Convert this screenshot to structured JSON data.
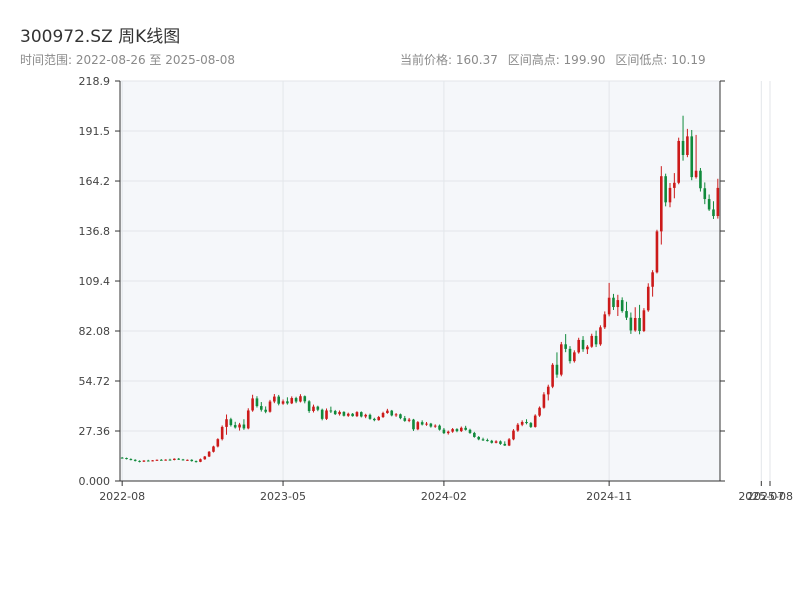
{
  "header": {
    "title": "300972.SZ 周K线图",
    "range_label": "时间范围: 2022-08-26 至 2025-08-08",
    "stats": [
      "当前价格: 160.37",
      "区间高点: 199.90",
      "区间低点: 10.19"
    ]
  },
  "chart_data": {
    "type": "candlestick",
    "title": "300972.SZ 周K线图",
    "ylim": [
      0,
      218.9
    ],
    "y_ticks": [
      "0.000",
      "27.36",
      "54.72",
      "82.08",
      "109.4",
      "136.8",
      "164.2",
      "191.5",
      "218.9"
    ],
    "y_tick_values": [
      0,
      27.36,
      54.72,
      82.08,
      109.44,
      136.8,
      164.16,
      191.52,
      218.9
    ],
    "x_ticks": [
      {
        "label": "2022-08",
        "index": 0
      },
      {
        "label": "2023-05",
        "index": 37
      },
      {
        "label": "2024-02",
        "index": 74
      },
      {
        "label": "2024-11",
        "index": 112
      },
      {
        "label": "2025-07",
        "index": 147
      },
      {
        "label": "2025-08",
        "index": 149
      }
    ],
    "grid": true,
    "colors": {
      "up": "#cc1a1a",
      "down": "#118a3c",
      "plot_bg": "#f5f7fa",
      "grid": "#e3e6ea",
      "axis": "#333333"
    },
    "candles": [
      [
        12.8,
        13.1,
        12.3,
        12.6
      ],
      [
        12.6,
        12.8,
        11.8,
        12.0
      ],
      [
        12.0,
        12.4,
        11.3,
        11.6
      ],
      [
        11.6,
        11.9,
        10.7,
        11.0
      ],
      [
        11.0,
        11.3,
        10.2,
        10.6
      ],
      [
        10.6,
        11.4,
        10.4,
        11.2
      ],
      [
        11.2,
        11.6,
        10.8,
        11.0
      ],
      [
        11.0,
        11.5,
        10.7,
        11.3
      ],
      [
        11.3,
        11.8,
        11.0,
        11.6
      ],
      [
        11.6,
        12.0,
        11.2,
        11.4
      ],
      [
        11.4,
        11.9,
        11.1,
        11.7
      ],
      [
        11.7,
        12.2,
        11.3,
        11.5
      ],
      [
        11.5,
        12.4,
        11.3,
        12.2
      ],
      [
        12.2,
        12.6,
        11.5,
        11.8
      ],
      [
        11.8,
        12.1,
        11.2,
        11.4
      ],
      [
        11.4,
        11.8,
        11.0,
        11.6
      ],
      [
        11.6,
        11.9,
        10.6,
        10.9
      ],
      [
        10.9,
        11.2,
        10.1,
        10.5
      ],
      [
        10.5,
        12.3,
        10.3,
        11.9
      ],
      [
        11.9,
        13.7,
        11.6,
        13.4
      ],
      [
        13.4,
        16.4,
        13.1,
        16.0
      ],
      [
        16.0,
        19.3,
        15.6,
        18.9
      ],
      [
        18.9,
        23.4,
        18.4,
        22.9
      ],
      [
        22.9,
        30.4,
        22.2,
        29.6
      ],
      [
        29.6,
        36.4,
        25.3,
        33.8
      ],
      [
        33.8,
        34.6,
        29.8,
        30.6
      ],
      [
        30.6,
        32.4,
        28.7,
        29.3
      ],
      [
        29.3,
        31.8,
        27.6,
        30.9
      ],
      [
        30.9,
        33.8,
        28.0,
        28.8
      ],
      [
        28.8,
        39.8,
        28.3,
        38.6
      ],
      [
        38.6,
        47.2,
        37.9,
        45.2
      ],
      [
        45.2,
        46.4,
        40.2,
        41.0
      ],
      [
        41.0,
        43.2,
        38.0,
        39.0
      ],
      [
        39.0,
        40.8,
        37.1,
        37.9
      ],
      [
        37.9,
        44.4,
        37.4,
        43.5
      ],
      [
        43.5,
        47.6,
        42.6,
        46.2
      ],
      [
        46.2,
        47.1,
        41.4,
        42.3
      ],
      [
        42.3,
        44.6,
        41.7,
        43.6
      ],
      [
        43.6,
        45.8,
        41.8,
        42.5
      ],
      [
        42.5,
        46.3,
        42.1,
        45.4
      ],
      [
        45.4,
        46.1,
        42.6,
        43.5
      ],
      [
        43.5,
        47.5,
        43.0,
        46.4
      ],
      [
        46.4,
        46.8,
        42.5,
        43.6
      ],
      [
        43.6,
        44.2,
        37.3,
        38.3
      ],
      [
        38.3,
        41.8,
        37.5,
        40.7
      ],
      [
        40.7,
        41.2,
        38.2,
        39.0
      ],
      [
        39.0,
        39.6,
        33.2,
        34.0
      ],
      [
        34.0,
        39.7,
        33.4,
        38.6
      ],
      [
        38.6,
        40.7,
        37.2,
        38.3
      ],
      [
        38.3,
        38.9,
        36.1,
        36.6
      ],
      [
        36.6,
        38.6,
        35.8,
        37.8
      ],
      [
        37.8,
        38.2,
        35.3,
        35.7
      ],
      [
        35.7,
        37.4,
        35.1,
        36.8
      ],
      [
        36.8,
        37.2,
        35.2,
        35.5
      ],
      [
        35.5,
        38.2,
        35.0,
        37.7
      ],
      [
        37.7,
        38.1,
        34.8,
        35.3
      ],
      [
        35.3,
        36.8,
        34.4,
        36.2
      ],
      [
        36.2,
        36.9,
        33.5,
        34.0
      ],
      [
        34.0,
        34.6,
        32.7,
        33.3
      ],
      [
        33.3,
        35.6,
        33.0,
        35.0
      ],
      [
        35.0,
        37.9,
        34.5,
        37.2
      ],
      [
        37.2,
        39.5,
        36.8,
        38.5
      ],
      [
        38.5,
        38.9,
        35.4,
        35.9
      ],
      [
        35.9,
        37.2,
        35.1,
        36.5
      ],
      [
        36.5,
        36.9,
        33.8,
        34.4
      ],
      [
        34.4,
        35.6,
        32.4,
        32.9
      ],
      [
        32.9,
        34.5,
        32.2,
        33.6
      ],
      [
        33.6,
        34.0,
        27.4,
        28.3
      ],
      [
        28.3,
        32.8,
        27.8,
        32.2
      ],
      [
        32.2,
        33.2,
        30.4,
        30.9
      ],
      [
        30.9,
        32.3,
        30.2,
        31.4
      ],
      [
        31.4,
        31.8,
        29.2,
        29.8
      ],
      [
        29.8,
        31.0,
        29.1,
        30.3
      ],
      [
        30.3,
        30.9,
        27.6,
        28.1
      ],
      [
        28.1,
        29.0,
        25.7,
        26.2
      ],
      [
        26.2,
        27.6,
        25.4,
        27.0
      ],
      [
        27.0,
        29.0,
        26.4,
        28.4
      ],
      [
        28.4,
        28.9,
        26.7,
        27.3
      ],
      [
        27.3,
        29.8,
        26.8,
        29.1
      ],
      [
        29.1,
        30.2,
        27.6,
        28.0
      ],
      [
        28.0,
        28.6,
        25.8,
        26.3
      ],
      [
        26.3,
        26.9,
        23.7,
        24.1
      ],
      [
        24.1,
        24.6,
        22.3,
        22.8
      ],
      [
        22.8,
        23.7,
        21.9,
        22.4
      ],
      [
        22.4,
        23.2,
        21.6,
        22.0
      ],
      [
        22.0,
        22.5,
        20.5,
        20.9
      ],
      [
        20.9,
        22.3,
        20.6,
        21.7
      ],
      [
        21.7,
        22.2,
        19.8,
        20.3
      ],
      [
        20.3,
        21.7,
        19.2,
        19.4
      ],
      [
        19.4,
        23.5,
        19.1,
        22.8
      ],
      [
        22.8,
        28.4,
        22.3,
        27.6
      ],
      [
        27.6,
        31.7,
        26.9,
        30.8
      ],
      [
        30.8,
        33.2,
        30.0,
        32.3
      ],
      [
        32.3,
        33.8,
        31.0,
        31.7
      ],
      [
        31.7,
        32.3,
        29.0,
        29.6
      ],
      [
        29.6,
        36.5,
        29.2,
        35.8
      ],
      [
        35.8,
        40.8,
        35.1,
        40.1
      ],
      [
        40.1,
        48.6,
        39.6,
        47.4
      ],
      [
        47.4,
        52.7,
        44.1,
        51.6
      ],
      [
        51.6,
        64.5,
        50.8,
        63.6
      ],
      [
        63.6,
        70.4,
        56.5,
        58.2
      ],
      [
        58.2,
        76.1,
        57.3,
        74.8
      ],
      [
        74.8,
        80.4,
        70.5,
        72.3
      ],
      [
        72.3,
        73.8,
        64.3,
        65.6
      ],
      [
        65.6,
        71.5,
        64.8,
        70.4
      ],
      [
        70.4,
        78.4,
        69.7,
        77.2
      ],
      [
        77.2,
        79.3,
        70.7,
        72.1
      ],
      [
        72.1,
        74.4,
        69.5,
        73.5
      ],
      [
        73.5,
        80.6,
        72.9,
        79.4
      ],
      [
        79.4,
        82.3,
        73.3,
        74.8
      ],
      [
        74.8,
        85.2,
        74.0,
        84.1
      ],
      [
        84.1,
        92.8,
        83.2,
        91.2
      ],
      [
        91.2,
        108.4,
        90.1,
        100.3
      ],
      [
        100.3,
        102.4,
        93.6,
        95.2
      ],
      [
        95.2,
        101.9,
        90.3,
        99.0
      ],
      [
        99.0,
        100.5,
        92.1,
        93.0
      ],
      [
        93.0,
        98.1,
        88.1,
        89.4
      ],
      [
        89.4,
        92.2,
        80.5,
        82.4
      ],
      [
        82.4,
        95.1,
        81.7,
        89.2
      ],
      [
        89.2,
        96.4,
        80.3,
        82.1
      ],
      [
        82.1,
        94.6,
        81.5,
        93.4
      ],
      [
        93.4,
        108.2,
        92.6,
        106.3
      ],
      [
        106.3,
        115.4,
        100.9,
        114.2
      ],
      [
        114.2,
        137.5,
        113.6,
        136.6
      ],
      [
        136.6,
        172.3,
        129.4,
        166.8
      ],
      [
        166.8,
        168.2,
        150.3,
        152.5
      ],
      [
        152.5,
        163.1,
        149.8,
        160.4
      ],
      [
        160.4,
        168.5,
        154.7,
        163.2
      ],
      [
        163.2,
        187.9,
        162.4,
        186.1
      ],
      [
        186.1,
        199.9,
        175.3,
        178.4
      ],
      [
        178.4,
        192.7,
        177.2,
        188.6
      ],
      [
        188.6,
        192.1,
        164.6,
        166.3
      ],
      [
        166.3,
        189.4,
        165.5,
        169.8
      ],
      [
        169.8,
        171.3,
        158.4,
        160.2
      ],
      [
        160.2,
        163.4,
        151.5,
        154.3
      ],
      [
        154.3,
        156.8,
        147.8,
        148.6
      ],
      [
        148.6,
        153.1,
        143.4,
        145.0
      ],
      [
        145.0,
        165.4,
        143.6,
        160.4
      ]
    ]
  }
}
